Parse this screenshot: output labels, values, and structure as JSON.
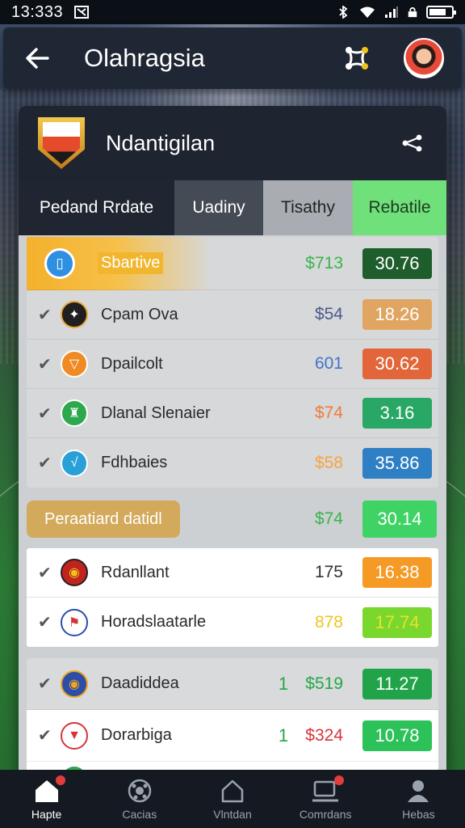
{
  "status_bar": {
    "time": "13:333"
  },
  "header": {
    "title": "Olahragsia"
  },
  "card": {
    "title": "Ndantigilan"
  },
  "tabs": [
    {
      "label": "Pedand Rrdate"
    },
    {
      "label": "Uadiny"
    },
    {
      "label": "Tisathy"
    },
    {
      "label": "Rebatile"
    }
  ],
  "featured": {
    "label": "Sbartive",
    "price": "$713",
    "value": "30.76",
    "price_color": "#39b54a",
    "badge_color": "#1d5e2c"
  },
  "group1": [
    {
      "name": "Cpam Ova",
      "price": "$54",
      "value": "18.26",
      "price_color": "#4a5a8a",
      "badge_color": "#e0a561",
      "logo_color": "#1f1f1f",
      "logo_glyph": "✦"
    },
    {
      "name": "Dpailcolt",
      "price": "601",
      "value": "30.62",
      "price_color": "#3f76c8",
      "badge_color": "#e2663a",
      "logo_color": "#f08a24",
      "logo_glyph": "▽"
    },
    {
      "name": "Dlanal Slenaier",
      "price": "$74",
      "price_color": "#ef7d3a",
      "value": "3.16",
      "badge_color": "#29a765",
      "logo_color": "#2ea84d",
      "logo_glyph": "♜"
    },
    {
      "name": "Fdhbaies",
      "price": "$58",
      "price_color": "#f5a540",
      "value": "35.86",
      "badge_color": "#2f7fc4",
      "logo_color": "#2aa0d8",
      "logo_glyph": "√"
    }
  ],
  "section": {
    "label": "Peraatiard datidl",
    "price": "$74",
    "value": "30.14",
    "price_color": "#39b54a",
    "badge_color": "#3fd365"
  },
  "group2": [
    {
      "name": "Rdanllant",
      "price": "175",
      "price_color": "#333333",
      "value": "16.38",
      "badge_color": "#f59a25",
      "logo_color": "#c0241c",
      "logo_glyph": "◉"
    },
    {
      "name": "Horadslaatarle",
      "price": "878",
      "price_color": "#f1c51c",
      "value": "17.74",
      "badge_color": "#7ad72d",
      "value_color": "#e8e22a",
      "logo_color": "#ffffff",
      "logo_glyph": "⚑"
    }
  ],
  "group3": [
    {
      "name": "Daadiddea",
      "vol": "1",
      "price": "$519",
      "price_color": "#25a845",
      "value": "11.27",
      "badge_color": "#21a449",
      "logo_color": "#2c4ea8",
      "logo_glyph": "◉"
    },
    {
      "name": "Dorarbiga",
      "vol": "1",
      "price": "$324",
      "price_color": "#d6343a",
      "value": "10.78",
      "badge_color": "#2dc15a",
      "logo_color": "#ffffff",
      "logo_glyph": "▼"
    }
  ],
  "nav": [
    {
      "label": "Hapte",
      "icon": "home-icon",
      "active": true,
      "dot": true
    },
    {
      "label": "Cacias",
      "icon": "ball-icon",
      "active": false,
      "dot": false
    },
    {
      "label": "Vlntdan",
      "icon": "house-icon",
      "active": false,
      "dot": false
    },
    {
      "label": "Comrdans",
      "icon": "monitor-icon",
      "active": false,
      "dot": true
    },
    {
      "label": "Hebas",
      "icon": "profile-icon",
      "active": false,
      "dot": false
    }
  ],
  "colors": {
    "accent_green": "#6fe07a",
    "header_bg": "#202734",
    "card_bg": "#1e2430"
  }
}
